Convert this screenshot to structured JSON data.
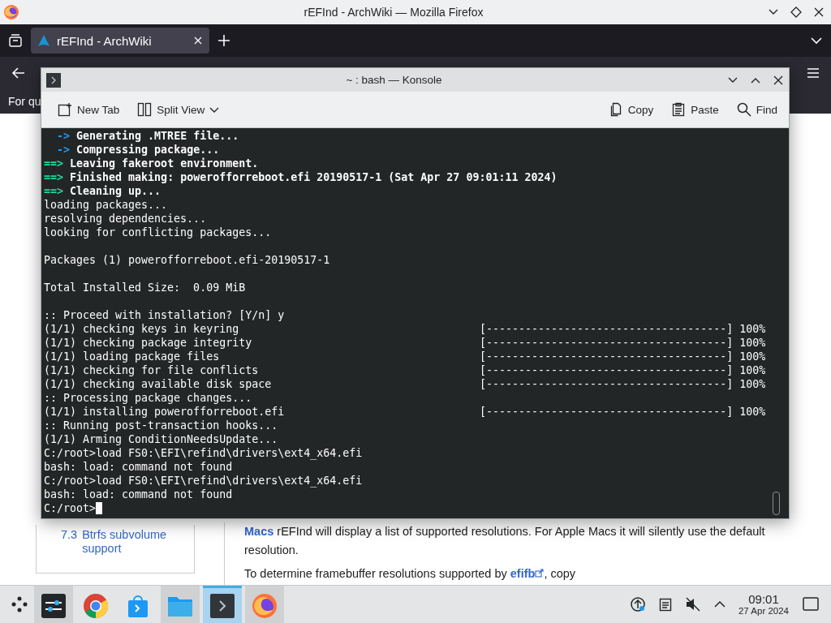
{
  "browser": {
    "title": "rEFInd - ArchWiki — Mozilla Firefox",
    "tabs": [
      {
        "label": "rEFInd - ArchWiki",
        "selected": true
      }
    ],
    "notice": "For qu",
    "toc_item": {
      "number": "7.3",
      "label": "Btrfs subvolume support"
    },
    "paragraphs": [
      {
        "link": "Macs",
        "after": " rEFInd will display a list of supported resolutions. For Apple Macs it will silently use the default resolution.",
        "external": false
      },
      {
        "before": "To determine framebuffer resolutions supported by ",
        "link": "efifb",
        "after": ", copy",
        "external": true
      }
    ]
  },
  "konsole": {
    "title": "~ : bash — Konsole",
    "toolbar_left": [
      {
        "label": "New Tab",
        "menu": false
      },
      {
        "label": "Split View",
        "menu": true
      }
    ],
    "toolbar_right": [
      {
        "label": "Copy"
      },
      {
        "label": "Paste"
      },
      {
        "label": "Find"
      }
    ],
    "lines": [
      {
        "kind": "arrow",
        "marker": "->",
        "text": "Generating .MTREE file..."
      },
      {
        "kind": "arrow",
        "marker": "->",
        "text": "Compressing package..."
      },
      {
        "kind": "stage",
        "marker": "==>",
        "text": "Leaving fakeroot environment."
      },
      {
        "kind": "stage",
        "marker": "==>",
        "text": "Finished making: powerofforreboot.efi 20190517-1 (Sat Apr 27 09:01:11 2024)"
      },
      {
        "kind": "stage",
        "marker": "==>",
        "text": "Cleaning up..."
      },
      {
        "kind": "plain",
        "text": "loading packages..."
      },
      {
        "kind": "plain",
        "text": "resolving dependencies..."
      },
      {
        "kind": "plain",
        "text": "looking for conflicting packages..."
      },
      {
        "kind": "blank"
      },
      {
        "kind": "plain",
        "text": "Packages (1) powerofforreboot.efi-20190517-1"
      },
      {
        "kind": "blank"
      },
      {
        "kind": "plain",
        "text": "Total Installed Size:  0.09 MiB"
      },
      {
        "kind": "blank"
      },
      {
        "kind": "plain",
        "text": ":: Proceed with installation? [Y/n] y"
      },
      {
        "kind": "progress",
        "text": "(1/1) checking keys in keyring",
        "bar": "[-------------------------------------]",
        "percent": "100%"
      },
      {
        "kind": "progress",
        "text": "(1/1) checking package integrity",
        "bar": "[-------------------------------------]",
        "percent": "100%"
      },
      {
        "kind": "progress",
        "text": "(1/1) loading package files",
        "bar": "[-------------------------------------]",
        "percent": "100%"
      },
      {
        "kind": "progress",
        "text": "(1/1) checking for file conflicts",
        "bar": "[-------------------------------------]",
        "percent": "100%"
      },
      {
        "kind": "progress",
        "text": "(1/1) checking available disk space",
        "bar": "[-------------------------------------]",
        "percent": "100%"
      },
      {
        "kind": "plain",
        "text": ":: Processing package changes..."
      },
      {
        "kind": "progress",
        "text": "(1/1) installing powerofforreboot.efi",
        "bar": "[-------------------------------------]",
        "percent": "100%"
      },
      {
        "kind": "plain",
        "text": ":: Running post-transaction hooks..."
      },
      {
        "kind": "plain",
        "text": "(1/1) Arming ConditionNeedsUpdate..."
      },
      {
        "kind": "plain",
        "text": "C:/root>load FS0:\\EFI\\refind\\drivers\\ext4_x64.efi"
      },
      {
        "kind": "plain",
        "text": "bash: load: command not found"
      },
      {
        "kind": "plain",
        "text": "C:/root>load FS0:\\EFI\\refind\\drivers\\ext4_x64.efi"
      },
      {
        "kind": "plain",
        "text": "bash: load: command not found"
      },
      {
        "kind": "prompt",
        "text": "C:/root>"
      }
    ]
  },
  "taskbar": {
    "apps": [
      {
        "open": true,
        "active": false
      },
      {
        "open": false,
        "active": false
      },
      {
        "open": false,
        "active": false
      },
      {
        "open": true,
        "active": false
      },
      {
        "open": true,
        "active": true
      },
      {
        "open": true,
        "active": false
      }
    ],
    "muted": true,
    "time": "09:01",
    "date": "27 Apr 2024"
  }
}
